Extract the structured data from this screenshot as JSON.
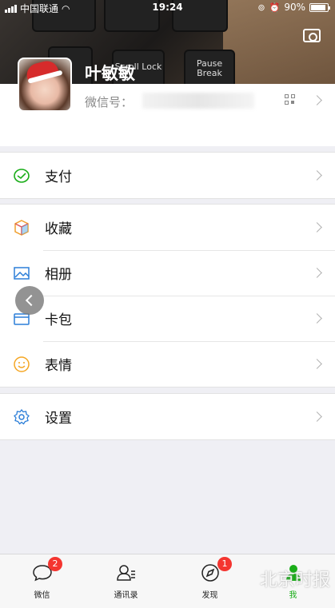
{
  "status_bar": {
    "carrier": "中国联通",
    "time": "19:24",
    "battery": "90%"
  },
  "header": {
    "background_keys": [
      "Scroll Lock",
      "Pause Break"
    ]
  },
  "profile": {
    "name": "叶敏敏",
    "wechat_id_label": "微信号："
  },
  "menu": {
    "pay": {
      "label": "支付",
      "icon": "wallet-icon",
      "color": "#1aad19"
    },
    "favorites": {
      "label": "收藏",
      "icon": "cube-icon",
      "color": "#f0a030"
    },
    "album": {
      "label": "相册",
      "icon": "image-icon",
      "color": "#2b7ed8"
    },
    "cards": {
      "label": "卡包",
      "icon": "card-icon",
      "color": "#2b7ed8"
    },
    "stickers": {
      "label": "表情",
      "icon": "smile-icon",
      "color": "#f5a623"
    },
    "settings": {
      "label": "设置",
      "icon": "gear-icon",
      "color": "#2b7ed8"
    }
  },
  "tabbar": {
    "tabs": [
      {
        "label": "微信",
        "icon": "chat-icon",
        "badge": "2"
      },
      {
        "label": "通讯录",
        "icon": "contacts-icon",
        "badge": ""
      },
      {
        "label": "发现",
        "icon": "compass-icon",
        "badge": "1"
      },
      {
        "label": "我",
        "icon": "person-icon",
        "badge": "",
        "active": true
      }
    ],
    "active_color": "#1aad19"
  },
  "watermark": "北京时报"
}
